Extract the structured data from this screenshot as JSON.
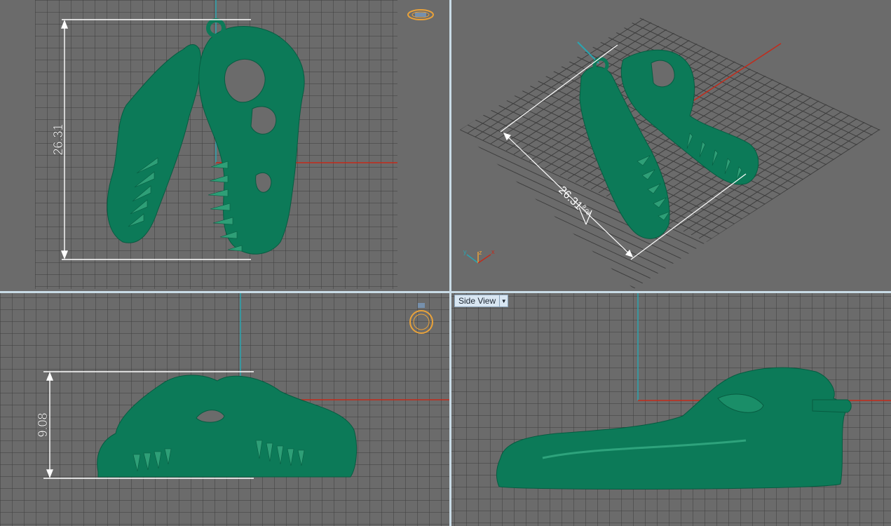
{
  "viewports": {
    "top": {
      "dimension_height": "26.31"
    },
    "perspective": {
      "dimension_length": "26.31",
      "dimension_small": "9.08",
      "axis_labels": {
        "y": "y",
        "z": "z",
        "x": "x"
      }
    },
    "front": {
      "dimension_height": "9.08"
    },
    "side": {
      "label": "Side View",
      "dropdown_icon": "triangle-down-icon"
    }
  },
  "colors": {
    "background": "#6b6b6b",
    "grid": "#3e3e3e",
    "model": "#0c7a58",
    "axis_x": "#c42a1a",
    "axis_y": "#2aa4b0",
    "gizmo": "#e9a23a",
    "dimension": "#ffffff",
    "viewport_separator": "#c9dbe6"
  }
}
